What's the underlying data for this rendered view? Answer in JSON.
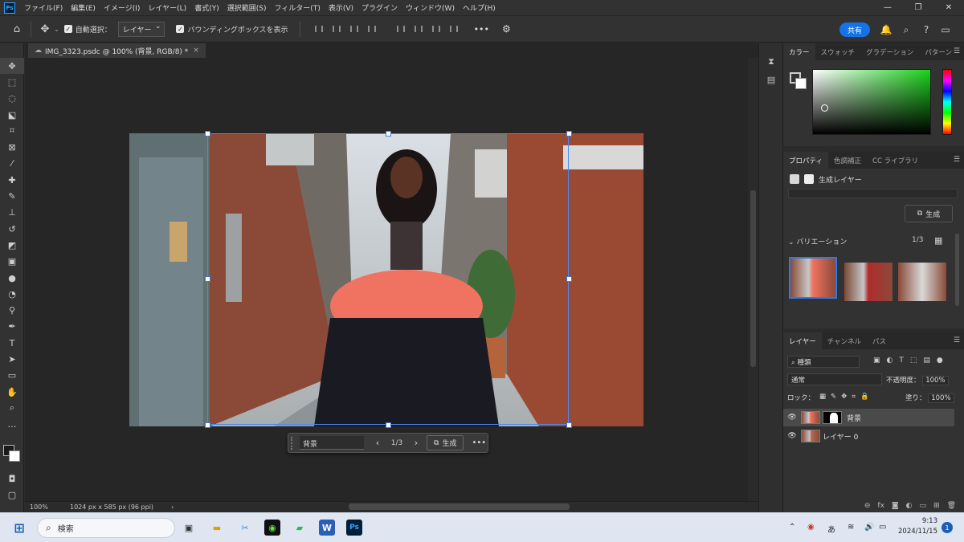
{
  "app": {
    "logo": "Ps"
  },
  "menu": [
    "ファイル(F)",
    "編集(E)",
    "イメージ(I)",
    "レイヤー(L)",
    "書式(Y)",
    "選択範囲(S)",
    "フィルター(T)",
    "表示(V)",
    "プラグイン",
    "ウィンドウ(W)",
    "ヘルプ(H)"
  ],
  "window_controls": {
    "minimize": "—",
    "restore": "❐",
    "close": "✕"
  },
  "options": {
    "auto_select_label": "自動選択：",
    "auto_select_value": "レイヤー",
    "bounding_box_label": "バウンディングボックスを表示",
    "more": "•••",
    "share_label": "共有"
  },
  "document": {
    "tab_title": "IMG_3323.psdc @ 100% (背景, RGB/8) *",
    "close": "×"
  },
  "context_bar": {
    "prompt_value": "背景",
    "variant_counter": "1/3",
    "generate_label": "生成",
    "more": "•••"
  },
  "status": {
    "zoom": "100%",
    "dimensions": "1024 px x 585 px (96 ppi)",
    "arrow": "›"
  },
  "color_panel": {
    "tabs": [
      "カラー",
      "スウォッチ",
      "グラデーション",
      "パターン"
    ],
    "active_tab": 0
  },
  "properties_panel": {
    "tabs": [
      "プロパティ",
      "色調補正",
      "CC ライブラリ"
    ],
    "layer_type": "生成レイヤー",
    "generate_label": "生成",
    "variations_label": "バリエーション",
    "variations_count": "1/3"
  },
  "layers_panel": {
    "tabs": [
      "レイヤー",
      "チャンネル",
      "パス"
    ],
    "filter_label": "種類",
    "blend_mode": "通常",
    "opacity_label": "不透明度：",
    "opacity_value": "100%",
    "lock_label": "ロック：",
    "fill_label": "塗り：",
    "fill_value": "100%",
    "layers": [
      {
        "name": "背景",
        "selected": true
      },
      {
        "name": "レイヤー 0",
        "selected": false
      }
    ]
  },
  "taskbar": {
    "search_placeholder": "検索",
    "time": "9:13",
    "date": "2024/11/15",
    "notifications": "1",
    "ime": "あ"
  }
}
